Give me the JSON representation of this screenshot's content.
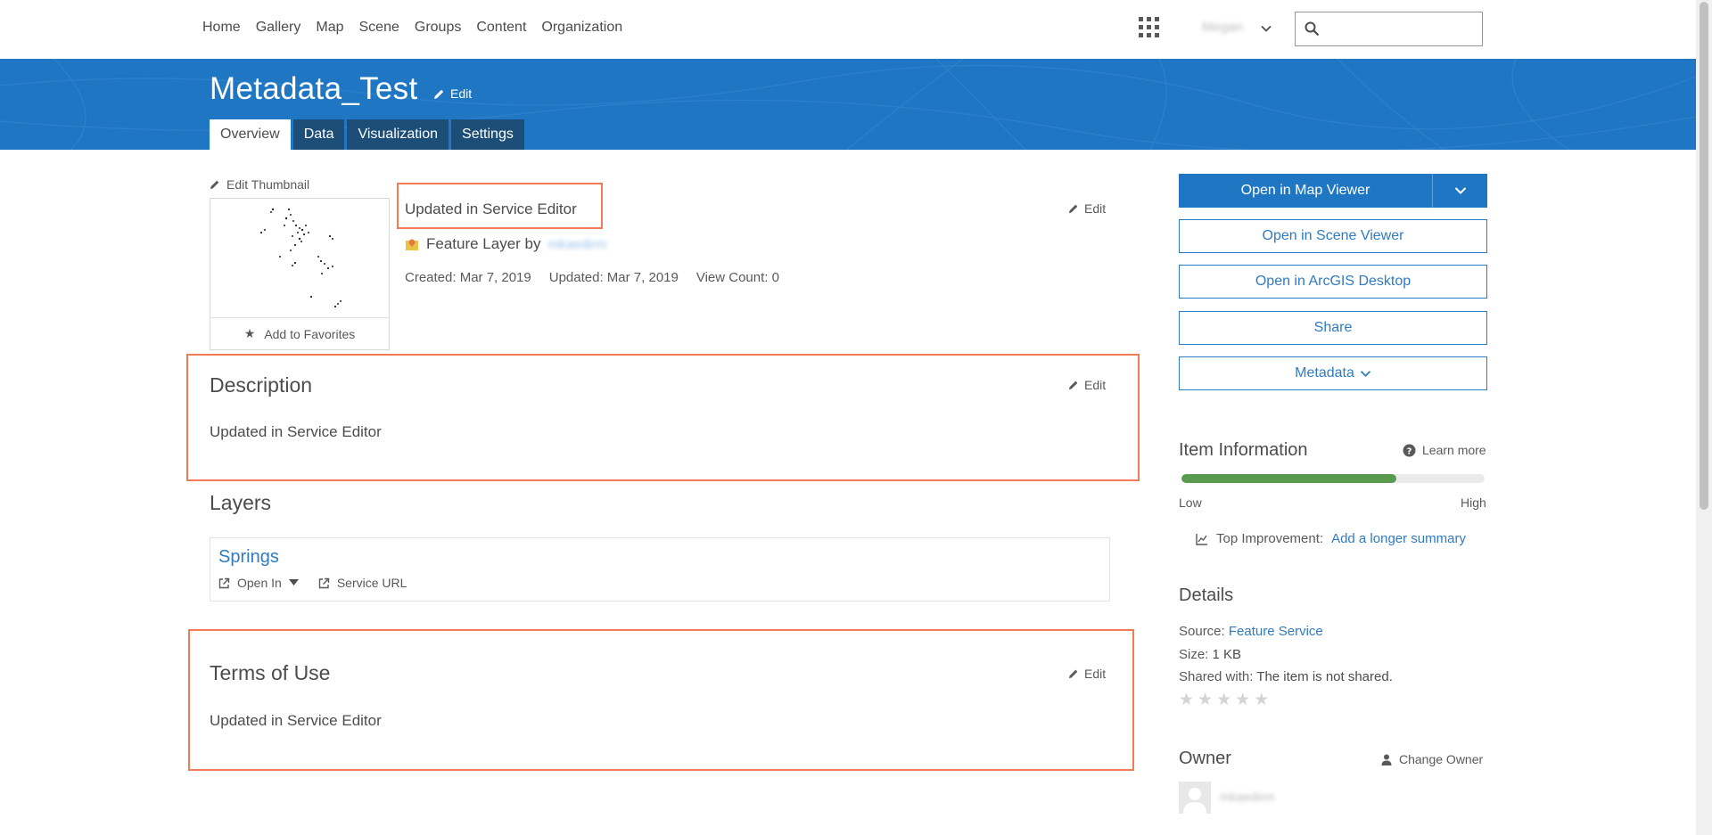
{
  "nav": {
    "items": [
      "Home",
      "Gallery",
      "Map",
      "Scene",
      "Groups",
      "Content",
      "Organization"
    ],
    "user_name": "Megan",
    "search_placeholder": ""
  },
  "item": {
    "title": "Metadata_Test",
    "title_edit": "Edit",
    "tabs": [
      "Overview",
      "Data",
      "Visualization",
      "Settings"
    ],
    "active_tab": "Overview",
    "edit_thumbnail": "Edit Thumbnail",
    "add_favorites": "Add to Favorites",
    "summary": "Updated in Service Editor",
    "edit": "Edit",
    "type_prefix": "Feature Layer by",
    "owner": "mkaedirm",
    "created": "Created: Mar 7, 2019",
    "updated": "Updated: Mar 7, 2019",
    "view_count": "View Count: 0"
  },
  "description": {
    "title": "Description",
    "text": "Updated in Service Editor"
  },
  "layers": {
    "title": "Layers",
    "items": [
      {
        "name": "Springs",
        "open_in": "Open In",
        "service_url": "Service URL"
      }
    ]
  },
  "terms": {
    "title": "Terms of Use",
    "text": "Updated in Service Editor"
  },
  "actions": {
    "open_map_viewer": "Open in Map Viewer",
    "open_scene_viewer": "Open in Scene Viewer",
    "open_arcgis_desktop": "Open in ArcGIS Desktop",
    "share": "Share",
    "metadata": "Metadata"
  },
  "item_info": {
    "title": "Item Information",
    "learn_more": "Learn more",
    "progress": 0.71,
    "low": "Low",
    "high": "High",
    "top_improvement_label": "Top Improvement:",
    "top_improvement_link": "Add a longer summary"
  },
  "details": {
    "title": "Details",
    "source_label": "Source:",
    "source_value": "Feature Service",
    "size_label": "Size:",
    "size_value": "1 KB",
    "shared_label": "Shared with:",
    "shared_value": "The item is not shared.",
    "rating": 0
  },
  "owner_section": {
    "title": "Owner",
    "change_owner": "Change Owner",
    "owner_name": "mkaedirm"
  },
  "colors": {
    "brand_blue": "#1f77c4",
    "tab_dark": "#1d4e78",
    "link": "#2f7bc2",
    "highlight": "#f07b54",
    "progress_green": "#5a9a4f"
  }
}
